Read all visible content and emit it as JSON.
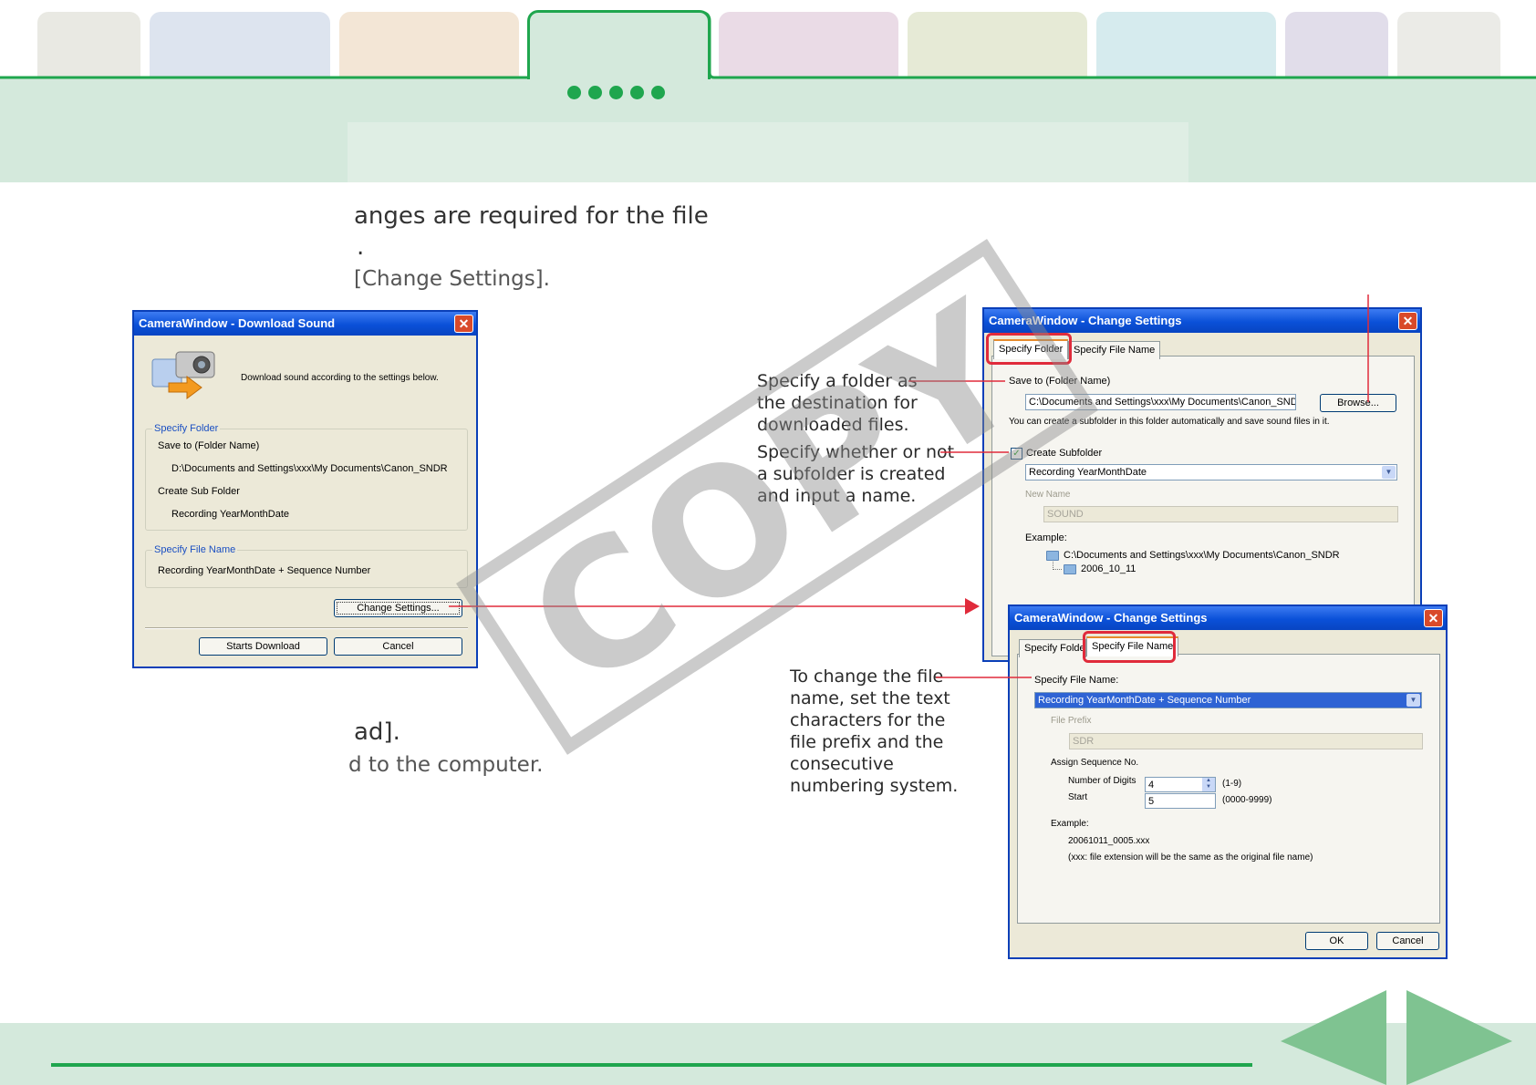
{
  "header": {
    "tab_colors": [
      "#e9e9e3",
      "#dde4ef",
      "#f3e6d6",
      "#d4e9dc",
      "#eadbe6",
      "#e6ead6",
      "#d6ebee",
      "#e1ddea",
      "#ebebe7"
    ],
    "accent": "#1fa64e",
    "active_tab_index": 3,
    "page_dots": 5
  },
  "body_text": {
    "line1": "anges are required for the file",
    "line2": ".",
    "line3": "[Change Settings].",
    "line4": "ad].",
    "line5": "d to the computer."
  },
  "watermark": "COPY",
  "download_dialog": {
    "title": "CameraWindow - Download Sound",
    "intro": "Download sound according to the settings below.",
    "folder_group_label": "Specify Folder",
    "save_to_label": "Save to (Folder Name)",
    "save_to_value": "D:\\Documents and Settings\\xxx\\My Documents\\Canon_SNDR",
    "subfolder_label": "Create Sub Folder",
    "subfolder_value": "Recording YearMonthDate",
    "filename_group_label": "Specify File Name",
    "filename_value": "Recording YearMonthDate + Sequence Number",
    "change_settings_button": "Change Settings...",
    "start_button": "Starts Download",
    "cancel_button": "Cancel"
  },
  "folder_dialog": {
    "title": "CameraWindow - Change Settings",
    "tab_folder": "Specify Folder",
    "tab_filename": "Specify File Name",
    "save_to_label": "Save to (Folder Name)",
    "path_value": "C:\\Documents and Settings\\xxx\\My Documents\\Canon_SNDR",
    "browse_button": "Browse...",
    "hint": "You can create a subfolder in this folder automatically and save sound files in it.",
    "create_subfolder_label": "Create Subfolder",
    "subfolder_option": "Recording YearMonthDate",
    "new_name_label": "New Name",
    "new_name_value": "SOUND",
    "example_label": "Example:",
    "example_path": "C:\\Documents and Settings\\xxx\\My Documents\\Canon_SNDR",
    "example_sub": "2006_10_11"
  },
  "filename_dialog": {
    "title": "CameraWindow - Change Settings",
    "tab_folder": "Specify Folde",
    "tab_filename": "Specify File Name",
    "specify_label": "Specify File Name:",
    "selected_option": "Recording YearMonthDate + Sequence Number",
    "prefix_label": "File Prefix",
    "prefix_value": "SDR",
    "assign_label": "Assign Sequence No.",
    "digits_label": "Number of Digits",
    "digits_value": "4",
    "digits_range": "(1-9)",
    "start_label": "Start",
    "start_value": "5",
    "start_range": "(0000-9999)",
    "example_label": "Example:",
    "example_value": "20061011_0005.xxx",
    "example_note": "(xxx: file extension will be the same as the original file name)",
    "ok_button": "OK",
    "cancel_button": "Cancel"
  },
  "annotations": {
    "folder": "Specify a folder as\nthe destination for\ndownloaded files.",
    "subfolder": "Specify whether or not\na subfolder is created\nand input a name.",
    "filename": "To change the file\nname, set the text\ncharacters for the\nfile prefix and the\nconsecutive\nnumbering system."
  },
  "footer": {
    "prev_label": "previous page",
    "next_label": "next page"
  }
}
